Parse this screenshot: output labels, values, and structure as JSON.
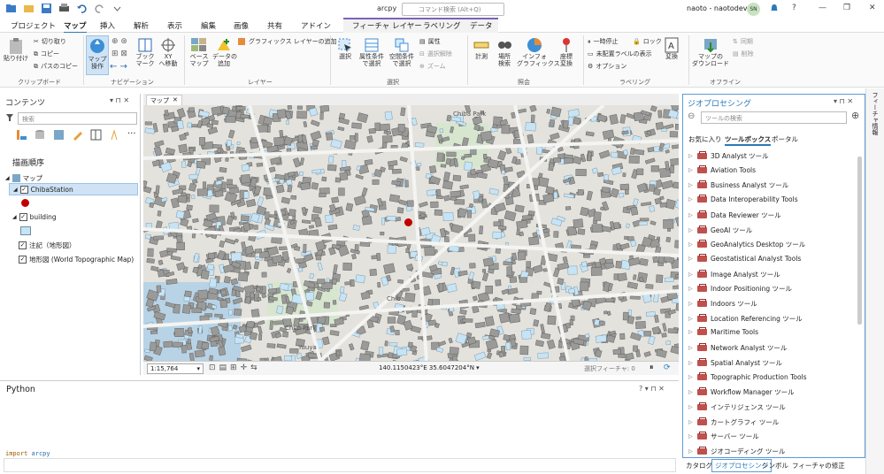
{
  "title": {
    "app": "arcpy",
    "search_placeholder": "コマンド検索 (Alt+Q)",
    "user": "naoto - naotodev",
    "initials": "SN"
  },
  "tabs": [
    "プロジェクト",
    "マップ",
    "挿入",
    "解析",
    "表示",
    "編集",
    "画像",
    "共有",
    "アドイン"
  ],
  "context_tabs": [
    "フィーチャ レイヤー",
    "ラベリング",
    "データ"
  ],
  "ribbon": {
    "clipboard": {
      "paste": "貼り付け",
      "cut": "切り取り",
      "copy": "コピー",
      "copy_path": "パスのコピー",
      "group": "クリップボード"
    },
    "navigation": {
      "explore": "マップ\n操作",
      "bookmarks": "ブック\nマーク",
      "xy": "XY\nへ移動",
      "group": "ナビゲーション"
    },
    "layer": {
      "basemap": "ベース\nマップ",
      "add_data": "データの\n追加",
      "add_graphics": "グラフィックス レイヤーの追加",
      "group": "レイヤー"
    },
    "selection": {
      "select": "選択",
      "by_attr": "属性条件\nで選択",
      "by_loc": "空間条件\nで選択",
      "attributes": "属性",
      "clear": "選択解除",
      "zoom": "ズーム",
      "group": "選択"
    },
    "inquiry": {
      "measure": "計測",
      "locate": "場所\n検索",
      "infographics": "インフォ\nグラフィックス",
      "convert": "座標\n変換",
      "group": "照会"
    },
    "labeling": {
      "pause": "一時停止",
      "lock": "ロック",
      "unplaced": "未配置ラベルの表示",
      "options": "オプション",
      "more": "変換",
      "group": "ラベリング"
    },
    "offline": {
      "download": "マップの\nダウンロード",
      "sync": "同期",
      "remove": "削除",
      "group": "オフライン"
    }
  },
  "contents": {
    "title": "コンテンツ",
    "search_placeholder": "検索",
    "drawing_order": "描画順序",
    "map": "マップ",
    "layers": [
      {
        "name": "ChibaStation",
        "checked": true,
        "selected": true
      },
      {
        "name": "building",
        "checked": true
      },
      {
        "name": "注記（地形図）",
        "checked": true
      },
      {
        "name": "地形図 (World Topographic Map)",
        "checked": true
      }
    ]
  },
  "map": {
    "tab": "マップ",
    "scale": "1:15,764",
    "coords": "140.1150423°E 35.6047204°N",
    "selected_features": "選択フィーチャ: 0",
    "labels": [
      "Chiba Park",
      "Chuo Park",
      "Chiba",
      "Yuuya"
    ]
  },
  "python": {
    "title": "Python",
    "code_keyword": "import",
    "code_module": "arcpy"
  },
  "geoprocessing": {
    "title": "ジオプロセシング",
    "search_placeholder": "ツールの検索",
    "tabs": [
      "お気に入り",
      "ツールボックス",
      "ポータル"
    ],
    "tools": [
      "3D Analyst ツール",
      "Aviation Tools",
      "Business Analyst ツール",
      "Data Interoperability Tools",
      "Data Reviewer ツール",
      "GeoAI ツール",
      "GeoAnalytics Desktop ツール",
      "Geostatistical Analyst Tools",
      "Image Analyst ツール",
      "Indoor Positioning ツール",
      "Indoors ツール",
      "Location Referencing ツール",
      "Maritime Tools",
      "Network Analyst ツール",
      "Spatial Analyst ツール",
      "Topographic Production Tools",
      "Workflow Manager ツール",
      "インテリジェンス ツール",
      "カートグラフィ ツール",
      "サーバー ツール",
      "ジオコーディング ツール"
    ]
  },
  "bottom_tabs": [
    "カタログ",
    "ジオプロセシング",
    "シンボル",
    "フィーチャの修正"
  ],
  "side_tab": "フィーチャ情報"
}
